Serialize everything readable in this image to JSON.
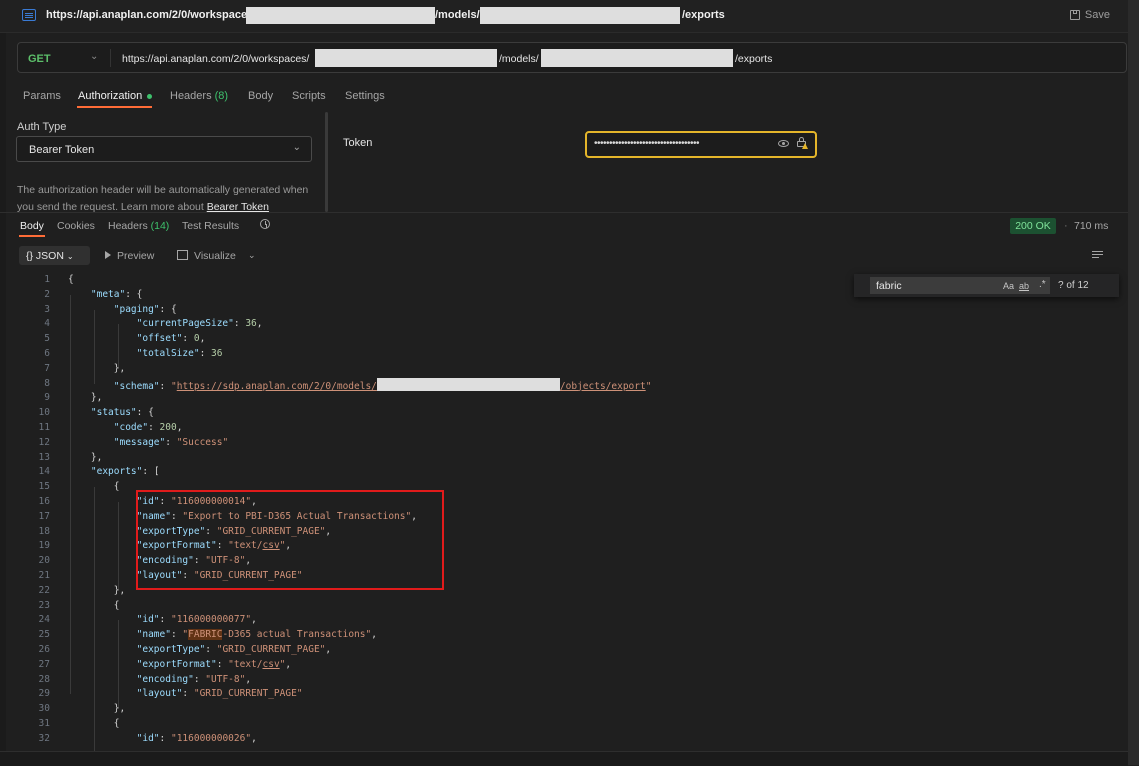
{
  "title_bar": {
    "url_part1": "https://api.anaplan.com/2/0/workspaces/",
    "url_part2": "/models/",
    "url_part3": "/exports",
    "save_label": "Save"
  },
  "request": {
    "method": "GET",
    "url_part1": "https://api.anaplan.com/2/0/workspaces/",
    "url_part2": "/models/",
    "url_part3": "/exports"
  },
  "request_tabs": {
    "params": "Params",
    "authorization": "Authorization",
    "headers": "Headers",
    "headers_count": "(8)",
    "body": "Body",
    "scripts": "Scripts",
    "settings": "Settings"
  },
  "auth": {
    "type_label": "Auth Type",
    "type_value": "Bearer Token",
    "description": "The authorization header will be automatically generated when you send the request. Learn more about ",
    "learn_more_link": "Bearer Token",
    "token_label": "Token",
    "token_value": "•••••••••••••••••••••••••••••••••••"
  },
  "response_tabs": {
    "body": "Body",
    "cookies": "Cookies",
    "headers": "Headers",
    "headers_count": "(14)",
    "test_results": "Test Results"
  },
  "response_status": {
    "status": "200 OK",
    "time": "710 ms"
  },
  "response_toolbar": {
    "format": "{} JSON",
    "preview": "Preview",
    "visualize": "Visualize"
  },
  "find_widget": {
    "query": "fabric",
    "match_case": "Aa",
    "whole_word": "ab",
    "regex": ".*",
    "result_count": "? of 12"
  },
  "code_lines": [
    {
      "n": "1",
      "parts": [
        [
          "p",
          "{"
        ]
      ]
    },
    {
      "n": "2",
      "parts": [
        [
          "p",
          "    "
        ],
        [
          "k",
          "\"meta\""
        ],
        [
          "p",
          ": {"
        ]
      ]
    },
    {
      "n": "3",
      "parts": [
        [
          "p",
          "        "
        ],
        [
          "k",
          "\"paging\""
        ],
        [
          "p",
          ": {"
        ]
      ]
    },
    {
      "n": "4",
      "parts": [
        [
          "p",
          "            "
        ],
        [
          "k",
          "\"currentPageSize\""
        ],
        [
          "p",
          ": "
        ],
        [
          "n",
          "36"
        ],
        [
          "p",
          ","
        ]
      ]
    },
    {
      "n": "5",
      "parts": [
        [
          "p",
          "            "
        ],
        [
          "k",
          "\"offset\""
        ],
        [
          "p",
          ": "
        ],
        [
          "n",
          "0"
        ],
        [
          "p",
          ","
        ]
      ]
    },
    {
      "n": "6",
      "parts": [
        [
          "p",
          "            "
        ],
        [
          "k",
          "\"totalSize\""
        ],
        [
          "p",
          ": "
        ],
        [
          "n",
          "36"
        ]
      ]
    },
    {
      "n": "7",
      "parts": [
        [
          "p",
          "        },"
        ]
      ]
    },
    {
      "n": "8",
      "parts": [
        [
          "p",
          "        "
        ],
        [
          "k",
          "\"schema\""
        ],
        [
          "p",
          ": "
        ],
        [
          "s",
          "\""
        ],
        [
          "su",
          "https://sdp.anaplan.com/2/0/models/"
        ],
        [
          "redact",
          ""
        ],
        [
          "su",
          "/objects/export"
        ],
        [
          "s",
          "\""
        ]
      ]
    },
    {
      "n": "9",
      "parts": [
        [
          "p",
          "    },"
        ]
      ]
    },
    {
      "n": "10",
      "parts": [
        [
          "p",
          "    "
        ],
        [
          "k",
          "\"status\""
        ],
        [
          "p",
          ": {"
        ]
      ]
    },
    {
      "n": "11",
      "parts": [
        [
          "p",
          "        "
        ],
        [
          "k",
          "\"code\""
        ],
        [
          "p",
          ": "
        ],
        [
          "n",
          "200"
        ],
        [
          "p",
          ","
        ]
      ]
    },
    {
      "n": "12",
      "parts": [
        [
          "p",
          "        "
        ],
        [
          "k",
          "\"message\""
        ],
        [
          "p",
          ": "
        ],
        [
          "s",
          "\"Success\""
        ]
      ]
    },
    {
      "n": "13",
      "parts": [
        [
          "p",
          "    },"
        ]
      ]
    },
    {
      "n": "14",
      "parts": [
        [
          "p",
          "    "
        ],
        [
          "k",
          "\"exports\""
        ],
        [
          "p",
          ": ["
        ]
      ]
    },
    {
      "n": "15",
      "parts": [
        [
          "p",
          "        {"
        ]
      ]
    },
    {
      "n": "16",
      "parts": [
        [
          "p",
          "            "
        ],
        [
          "k",
          "\"id\""
        ],
        [
          "p",
          ": "
        ],
        [
          "s",
          "\"116000000014\""
        ],
        [
          "p",
          ","
        ]
      ]
    },
    {
      "n": "17",
      "parts": [
        [
          "p",
          "            "
        ],
        [
          "k",
          "\"name\""
        ],
        [
          "p",
          ": "
        ],
        [
          "s",
          "\"Export to PBI-D365 Actual Transactions\""
        ],
        [
          "p",
          ","
        ]
      ]
    },
    {
      "n": "18",
      "parts": [
        [
          "p",
          "            "
        ],
        [
          "k",
          "\"exportType\""
        ],
        [
          "p",
          ": "
        ],
        [
          "s",
          "\"GRID_CURRENT_PAGE\""
        ],
        [
          "p",
          ","
        ]
      ]
    },
    {
      "n": "19",
      "parts": [
        [
          "p",
          "            "
        ],
        [
          "k",
          "\"exportFormat\""
        ],
        [
          "p",
          ": "
        ],
        [
          "s",
          "\"text/"
        ],
        [
          "su",
          "csv"
        ],
        [
          "s",
          "\""
        ],
        [
          "p",
          ","
        ]
      ]
    },
    {
      "n": "20",
      "parts": [
        [
          "p",
          "            "
        ],
        [
          "k",
          "\"encoding\""
        ],
        [
          "p",
          ": "
        ],
        [
          "s",
          "\"UTF-8\""
        ],
        [
          "p",
          ","
        ]
      ]
    },
    {
      "n": "21",
      "parts": [
        [
          "p",
          "            "
        ],
        [
          "k",
          "\"layout\""
        ],
        [
          "p",
          ": "
        ],
        [
          "s",
          "\"GRID_CURRENT_PAGE\""
        ]
      ]
    },
    {
      "n": "22",
      "parts": [
        [
          "p",
          "        },"
        ]
      ]
    },
    {
      "n": "23",
      "parts": [
        [
          "p",
          "        {"
        ]
      ]
    },
    {
      "n": "24",
      "parts": [
        [
          "p",
          "            "
        ],
        [
          "k",
          "\"id\""
        ],
        [
          "p",
          ": "
        ],
        [
          "s",
          "\"116000000077\""
        ],
        [
          "p",
          ","
        ]
      ]
    },
    {
      "n": "25",
      "parts": [
        [
          "p",
          "            "
        ],
        [
          "k",
          "\"name\""
        ],
        [
          "p",
          ": "
        ],
        [
          "s",
          "\""
        ],
        [
          "hl",
          "FABRIC"
        ],
        [
          "s",
          "-D365 actual Transactions\""
        ],
        [
          "p",
          ","
        ]
      ]
    },
    {
      "n": "26",
      "parts": [
        [
          "p",
          "            "
        ],
        [
          "k",
          "\"exportType\""
        ],
        [
          "p",
          ": "
        ],
        [
          "s",
          "\"GRID_CURRENT_PAGE\""
        ],
        [
          "p",
          ","
        ]
      ]
    },
    {
      "n": "27",
      "parts": [
        [
          "p",
          "            "
        ],
        [
          "k",
          "\"exportFormat\""
        ],
        [
          "p",
          ": "
        ],
        [
          "s",
          "\"text/"
        ],
        [
          "su",
          "csv"
        ],
        [
          "s",
          "\""
        ],
        [
          "p",
          ","
        ]
      ]
    },
    {
      "n": "28",
      "parts": [
        [
          "p",
          "            "
        ],
        [
          "k",
          "\"encoding\""
        ],
        [
          "p",
          ": "
        ],
        [
          "s",
          "\"UTF-8\""
        ],
        [
          "p",
          ","
        ]
      ]
    },
    {
      "n": "29",
      "parts": [
        [
          "p",
          "            "
        ],
        [
          "k",
          "\"layout\""
        ],
        [
          "p",
          ": "
        ],
        [
          "s",
          "\"GRID_CURRENT_PAGE\""
        ]
      ]
    },
    {
      "n": "30",
      "parts": [
        [
          "p",
          "        },"
        ]
      ]
    },
    {
      "n": "31",
      "parts": [
        [
          "p",
          "        {"
        ]
      ]
    },
    {
      "n": "32",
      "parts": [
        [
          "p",
          "            "
        ],
        [
          "k",
          "\"id\""
        ],
        [
          "p",
          ": "
        ],
        [
          "s",
          "\"116000000026\""
        ],
        [
          "p",
          ","
        ]
      ]
    }
  ],
  "colors": {
    "accent": "#ff6c37",
    "method_get": "#5cbf6a",
    "status_ok_bg": "#1c5131",
    "token_border": "#e4b52a",
    "annotation_red": "#e01b1b"
  }
}
